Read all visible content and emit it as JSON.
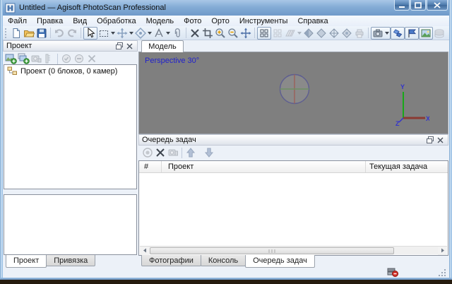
{
  "window": {
    "title": "Untitled — Agisoft PhotoScan Professional"
  },
  "menu": {
    "items": [
      "Файл",
      "Правка",
      "Вид",
      "Обработка",
      "Модель",
      "Фото",
      "Орто",
      "Инструменты",
      "Справка"
    ]
  },
  "toolbar": {
    "icons": [
      "new-project",
      "open-project",
      "save-project",
      "undo",
      "redo",
      "select-tool",
      "rectangle-selection",
      "move-object",
      "navigation",
      "ruler",
      "attach",
      "delete-selection",
      "crop",
      "zoom-in",
      "zoom-out",
      "reset-view",
      "point-cloud-view",
      "dense-cloud-view",
      "mesh-view",
      "shaded-view",
      "solid-view",
      "wireframe-view",
      "textured-view",
      "orthophoto-view",
      "show-cameras",
      "show-markers",
      "show-labels",
      "show-images",
      "stack-view"
    ]
  },
  "workspace": {
    "title": "Проект",
    "tree_item": "Проект (0 блоков, 0 камер)",
    "tabs": [
      "Проект",
      "Привязка"
    ],
    "active_tab": "Проект",
    "tool_icons": [
      "add-chunk",
      "add-photos",
      "add-marker",
      "add-scalebar",
      "enable-item",
      "disable-item",
      "remove-item"
    ]
  },
  "viewport": {
    "tab": "Модель",
    "overlay": "Perspective 30°",
    "axis": {
      "x": "X",
      "y": "Y",
      "z": "Z"
    }
  },
  "task_queue": {
    "title": "Очередь задач",
    "columns": [
      "#",
      "Проект",
      "Текущая задача"
    ],
    "rows": [],
    "tool_icons": [
      "pause-queue",
      "remove-task",
      "task-preview",
      "move-task-up",
      "move-task-down"
    ],
    "tabs": [
      "Фотографии",
      "Консоль",
      "Очередь задач"
    ],
    "active_tab": "Очередь задач"
  },
  "colors": {
    "titlebar_blue": "#84acd6",
    "viewport_gray": "#7f7f7f",
    "overlay_text": "#2222cc",
    "axis_x_red": "#8b3a32",
    "axis_y_green": "#18a818",
    "axis_label_blue": "#3333cc",
    "accent_blue": "#4a7ac8"
  }
}
